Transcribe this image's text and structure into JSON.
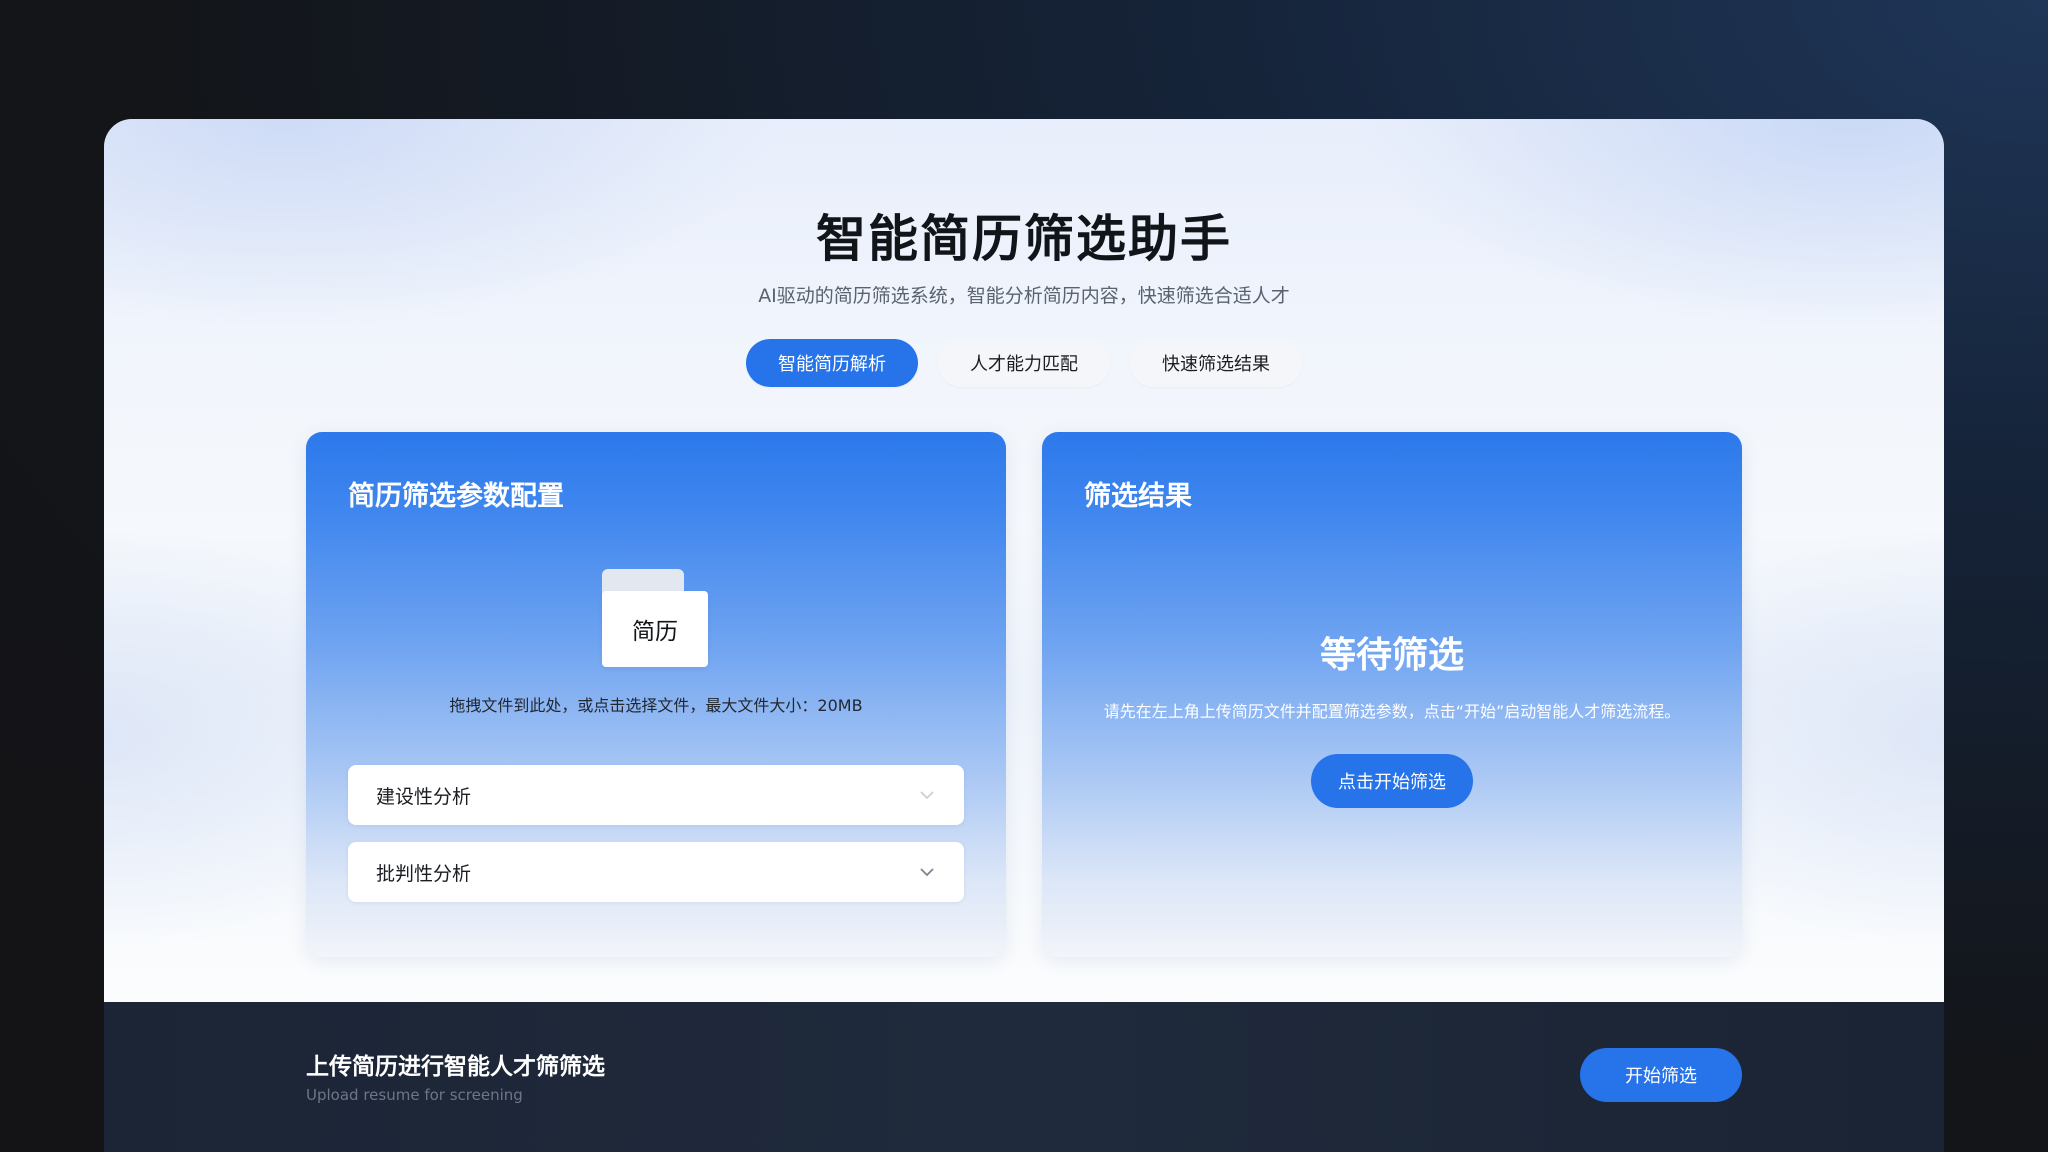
{
  "header": {
    "title": "智能简历筛选助手",
    "subtitle": "AI驱动的简历筛选系统，智能分析简历内容，快速筛选合适人才"
  },
  "tabs": [
    {
      "label": "智能简历解析",
      "active": true
    },
    {
      "label": "人才能力匹配",
      "active": false
    },
    {
      "label": "快速筛选结果",
      "active": false
    }
  ],
  "config_panel": {
    "title": "简历筛选参数配置",
    "file_icon_label": "简历",
    "drop_hint": "拖拽文件到此处，或点击选择文件，最大文件大小：20MB",
    "selects": [
      {
        "value": "建设性分析"
      },
      {
        "value": "批判性分析"
      }
    ]
  },
  "result_panel": {
    "title": "筛选结果",
    "status": "等待筛选",
    "description": "请先在左上角上传简历文件并配置筛选参数，点击“开始”启动智能人才筛选流程。",
    "start_label": "点击开始筛选"
  },
  "footer": {
    "title": "上传简历进行智能人才筛筛选",
    "subtitle": "Upload resume for screening",
    "start_label": "开始筛选"
  },
  "colors": {
    "accent": "#2673ea",
    "footer_bg": "#1f2a3c",
    "panel_top": "#2c79ec"
  }
}
